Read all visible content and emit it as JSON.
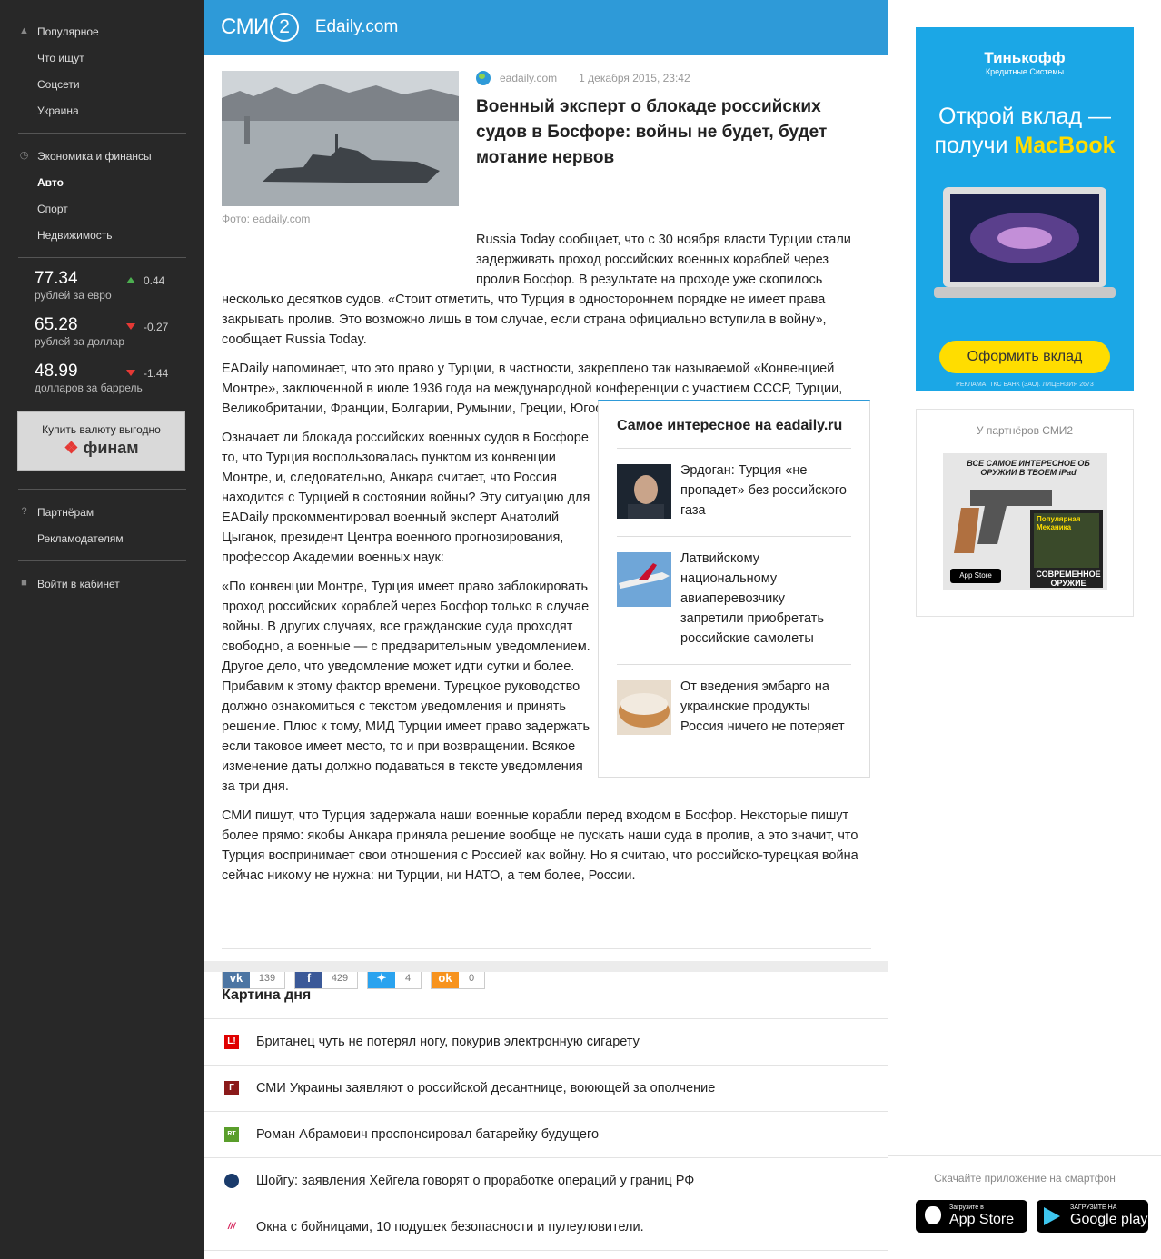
{
  "sidebar": {
    "group1": [
      "Популярное",
      "Что ищут",
      "Соцсети",
      "Украина"
    ],
    "group2": [
      "Экономика и финансы",
      "Авто",
      "Спорт",
      "Недвижимость"
    ],
    "rates": [
      {
        "value": "77.34",
        "label": "рублей за евро",
        "change": "0.44",
        "dir": "up"
      },
      {
        "value": "65.28",
        "label": "рублей за доллар",
        "change": "-0.27",
        "dir": "down"
      },
      {
        "value": "48.99",
        "label": "долларов за баррель",
        "change": "-1.44",
        "dir": "down"
      }
    ],
    "finam": {
      "text": "Купить валюту выгодно",
      "logo": "финам"
    },
    "group3": [
      "Партнёрам",
      "Рекламодателям"
    ],
    "login": "Войти в кабинет"
  },
  "header": {
    "logo": "СМИ",
    "logo_num": "2",
    "site": "Edaily.com"
  },
  "article": {
    "photo_caption": "Фото: eadaily.com",
    "source": "eadaily.com",
    "date": "1 декабря 2015, 23:42",
    "title": "Военный эксперт о блокаде российских судов в Босфоре: войны не будет, будет мотание нервов",
    "p1_a": "Russia Today сообщает, что с 30 ноября власти Турции стали задерживать проход российских военных кораблей через пролив Босфор. В результате на проходе уже скопилось",
    "p1_b": "несколько десятков судов. «Стоит отметить, что Турция в одностороннем порядке не имеет права закрывать пролив. Это возможно лишь в том случае, если страна официально вступила в войну», сообщает Russia Today.",
    "p2": "EADaily напоминает, что это право у Турции, в частности, закреплено так называемой «Конвенцией Монтре», заключенной в июле 1936 года на международной конференции с участием СССР, Турции, Великобритании, Франции, Болгарии, Румынии, Греции, Югославии, Австралии и Японии.",
    "p3": "Означает ли блокада российских военных судов в Босфоре то, что Турция воспользовалась пунктом из конвенции Монтре, и, следовательно, Анкара считает, что Россия находится с Турцией в состоянии войны? Эту ситуацию для EADaily прокомментировал военный эксперт Анатолий Цыганок, президент Центра военного прогнозирования, профессор Академии военных наук:",
    "p4_a": "«По конвенции Монтре, Турция имеет право заблокировать проход российских кораблей через Босфор только в случае войны. В других случаях, все гражданские суда проходят свободно, а военные — с предварительным уведомлением. Другое дело, что уведомление может идти сутки и более. Прибавим к этому фактор времени. Турецкое руководство должно ознакомиться с текстом уведомления и принять решение. Плюс к тому, МИД Турции имеет право задержать",
    "p4_b": "если таковое имеет место, то и при возвращении. Всякое изменение даты должно подаваться в тексте уведомления за три дня.",
    "p5": "СМИ пишут, что Турция задержала наши военные корабли перед входом в Босфор. Некоторые пишут более прямо: якобы Анкара приняла решение вообще не пускать наши суда в пролив, а это значит, что Турция воспринимает свои отношения с Россией как войну. Но я считаю, что российско-турецкая война сейчас никому не нужна: ни Турции, ни НАТО, а тем более, России."
  },
  "interesting": {
    "title": "Самое интересное на eadaily.ru",
    "items": [
      "Эрдоган: Турция «не пропадет» без российского газа",
      "Латвийскому национальному авиаперевозчику запретили приобретать российские самолеты",
      "От введения эмбарго на украинские продукты Россия ничего не потеряет"
    ]
  },
  "shares": [
    {
      "icon": "vk-icon",
      "count": "139",
      "color": "#4c75a3"
    },
    {
      "icon": "facebook-icon",
      "count": "429",
      "color": "#3b5998"
    },
    {
      "icon": "twitter-icon",
      "count": "4",
      "color": "#2aa3ef"
    },
    {
      "icon": "odnoklassniki-icon",
      "count": "0",
      "color": "#f7931e"
    }
  ],
  "kartina": {
    "title": "Картина дня",
    "items": [
      {
        "text": "Британец чуть не потерял ногу, покурив электронную сигарету",
        "icon": "L!",
        "color": "#e00000"
      },
      {
        "text": "СМИ Украины заявляют о российской десантнице, воюющей за ополчение",
        "icon": "Г",
        "color": "#8b1a1a"
      },
      {
        "text": "Роман Абрамович проспонсировал батарейку будущего",
        "icon": "RT",
        "color": "#5a9e2b"
      },
      {
        "text": "Шойгу: заявления Хейгела говорят о проработке операций у границ РФ",
        "icon": "",
        "color": "#1a3b6b"
      },
      {
        "text": "Окна с бойницами, 10 подушек безопасности и пулеуловители.",
        "icon": "///",
        "color": "#d6245b"
      }
    ]
  },
  "ad": {
    "brand": "Тинькофф",
    "brand_sub": "Кредитные Системы",
    "line1": "Открой вклад —",
    "line2_a": "получи ",
    "line2_b": "MacBook",
    "button": "Оформить вклад",
    "fine": "РЕКЛАМА. ТКС БАНК (ЗАО). ЛИЦЕНЗИЯ 2673"
  },
  "partners": {
    "title": "У партнёров СМИ2",
    "banner_top": "ВСЕ САМОЕ ИНТЕРЕСНОЕ ОБ ОРУЖИИ В ТВОЕМ iPad",
    "banner_mag": "Популярная Механика",
    "banner_bottom": "СОВРЕМЕННОЕ ОРУЖИЕ",
    "banner_store": "App Store"
  },
  "apps": {
    "title": "Скачайте приложение на смартфон",
    "appstore_small": "Загрузите в",
    "appstore": "App Store",
    "google_small": "ЗАГРУЗИТЕ НА",
    "google": "Google play"
  }
}
